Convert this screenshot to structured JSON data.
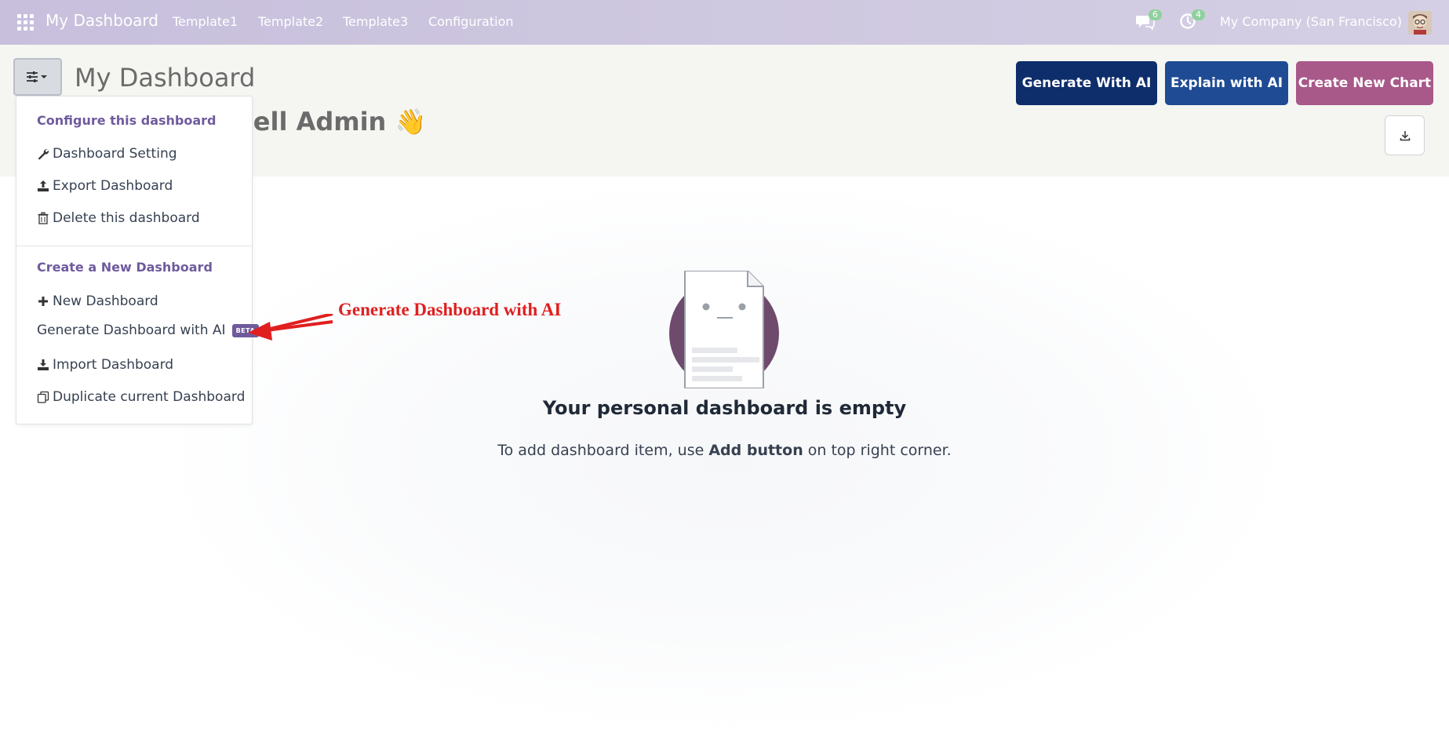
{
  "navbar": {
    "brand": "My Dashboard",
    "menu": [
      "Template1",
      "Template2",
      "Template3",
      "Configuration"
    ],
    "messages_count": "6",
    "activities_count": "4",
    "company": "My Company (San Francisco)",
    "icons": [
      "apps-grid-icon",
      "chat-icon",
      "clock-icon",
      "avatar"
    ]
  },
  "header": {
    "title": "My Dashboard",
    "greeting": "hell Admin 👋",
    "buttons": {
      "generate": "Generate With AI",
      "explain": "Explain with AI",
      "create": "Create New Chart"
    }
  },
  "dropdown": {
    "section1_title": "Configure this dashboard",
    "dashboard_setting": "Dashboard Setting",
    "export": "Export Dashboard",
    "delete": "Delete this dashboard",
    "section2_title": "Create a New Dashboard",
    "new_dashboard": "New Dashboard",
    "generate_ai": "Generate Dashboard with AI",
    "beta": "BETA",
    "import": "Import Dashboard",
    "duplicate": "Duplicate current Dashboard"
  },
  "annotation": {
    "text": "Generate Dashboard with AI"
  },
  "empty_state": {
    "title": "Your personal dashboard is empty",
    "sub_before": "To add dashboard item, use ",
    "sub_bold": "Add button",
    "sub_after": " on top right corner."
  },
  "colors": {
    "navbar": "#c9c2dd",
    "accent_purple": "#6f5b9c",
    "btn_generate": "#0d2d6b",
    "btn_explain": "#1f4b94",
    "btn_create": "#a85889",
    "annotation_red": "#e01f1f",
    "badge_green": "#8fd19e"
  }
}
